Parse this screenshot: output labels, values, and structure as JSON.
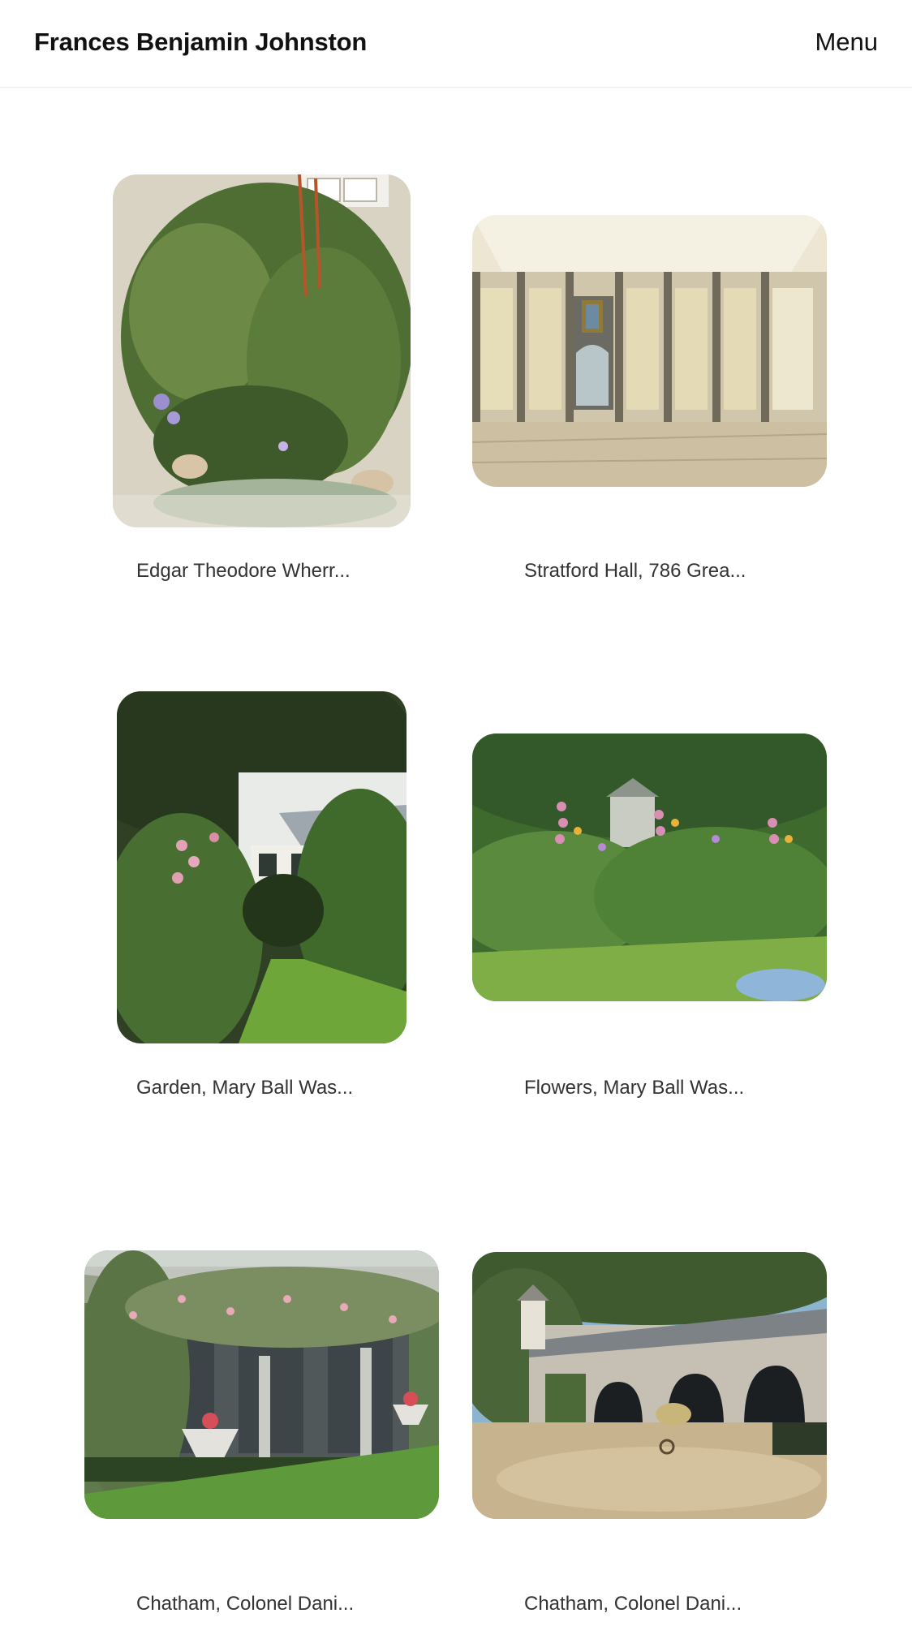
{
  "header": {
    "title": "Frances Benjamin Johnston",
    "menu_label": "Menu"
  },
  "gallery": {
    "items": [
      {
        "caption": "Edgar Theodore Wherr...",
        "subject": "garden-ferns-pond"
      },
      {
        "caption": "Stratford Hall, 786 Grea...",
        "subject": "paneled-hall-interior"
      },
      {
        "caption": "Garden, Mary Ball Was...",
        "subject": "garden-hollyhocks-house"
      },
      {
        "caption": "Flowers, Mary Ball Was...",
        "subject": "flower-border-garden"
      },
      {
        "caption": "Chatham, Colonel Dani...",
        "subject": "pergola-colonnade"
      },
      {
        "caption": "Chatham, Colonel Dani...",
        "subject": "arched-courtyard-dovecote"
      }
    ]
  }
}
